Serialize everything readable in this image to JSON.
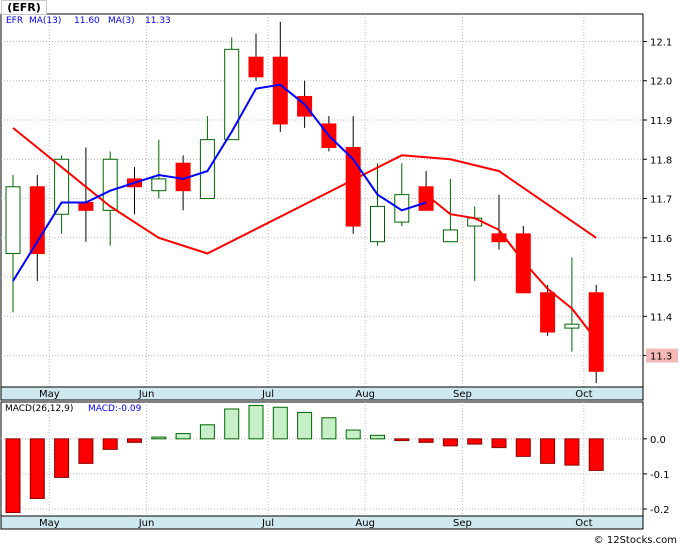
{
  "ticker_label": "(EFR)",
  "copyright": "© 12Stocks.com",
  "colors": {
    "up_fill": "#ffffff",
    "up_outline": "#006400",
    "down_fill": "#ff0000",
    "ma_fast": "#0000ff",
    "ma_slow": "#ff0000",
    "macd_pos_fill": "#c8f0c8",
    "macd_pos_outline": "#006400",
    "macd_neg_fill": "#ff0000",
    "axis_band": "#cfe8f0",
    "last_price_box": "#f4b8b8"
  },
  "chart_data": [
    {
      "type": "candlestick",
      "legend": {
        "symbol": "EFR",
        "ma13_label": "MA(13)",
        "ma13_value": "11.60",
        "ma3_label": "MA(3)",
        "ma3_value": "11.33"
      },
      "ylim": [
        11.22,
        12.17
      ],
      "y_ticks": [
        "11.3",
        "11.4",
        "11.5",
        "11.6",
        "11.7",
        "11.8",
        "11.9",
        "12.0",
        "12.1"
      ],
      "last_price_label": "11.3",
      "x_month_labels": [
        "May",
        "Jun",
        "Jul",
        "Aug",
        "Sep",
        "Oct"
      ],
      "candles": [
        {
          "o": 11.56,
          "h": 11.76,
          "l": 11.41,
          "c": 11.73
        },
        {
          "o": 11.73,
          "h": 11.76,
          "l": 11.49,
          "c": 11.56
        },
        {
          "o": 11.66,
          "h": 11.81,
          "l": 11.61,
          "c": 11.8
        },
        {
          "o": 11.69,
          "h": 11.83,
          "l": 11.59,
          "c": 11.67
        },
        {
          "o": 11.67,
          "h": 11.82,
          "l": 11.58,
          "c": 11.8
        },
        {
          "o": 11.75,
          "h": 11.78,
          "l": 11.66,
          "c": 11.73
        },
        {
          "o": 11.72,
          "h": 11.85,
          "l": 11.7,
          "c": 11.75
        },
        {
          "o": 11.79,
          "h": 11.81,
          "l": 11.67,
          "c": 11.72
        },
        {
          "o": 11.7,
          "h": 11.91,
          "l": 11.7,
          "c": 11.85
        },
        {
          "o": 11.85,
          "h": 12.11,
          "l": 11.85,
          "c": 12.08
        },
        {
          "o": 12.06,
          "h": 12.12,
          "l": 12.0,
          "c": 12.01
        },
        {
          "o": 12.06,
          "h": 12.15,
          "l": 11.87,
          "c": 11.89
        },
        {
          "o": 11.96,
          "h": 12.0,
          "l": 11.88,
          "c": 11.91
        },
        {
          "o": 11.89,
          "h": 11.91,
          "l": 11.82,
          "c": 11.83
        },
        {
          "o": 11.83,
          "h": 11.91,
          "l": 11.61,
          "c": 11.63
        },
        {
          "o": 11.59,
          "h": 11.79,
          "l": 11.58,
          "c": 11.68
        },
        {
          "o": 11.64,
          "h": 11.79,
          "l": 11.63,
          "c": 11.71
        },
        {
          "o": 11.73,
          "h": 11.77,
          "l": 11.67,
          "c": 11.67
        },
        {
          "o": 11.59,
          "h": 11.75,
          "l": 11.59,
          "c": 11.62
        },
        {
          "o": 11.63,
          "h": 11.68,
          "l": 11.49,
          "c": 11.65
        },
        {
          "o": 11.61,
          "h": 11.71,
          "l": 11.57,
          "c": 11.59
        },
        {
          "o": 11.61,
          "h": 11.63,
          "l": 11.46,
          "c": 11.46
        },
        {
          "o": 11.46,
          "h": 11.48,
          "l": 11.35,
          "c": 11.36
        },
        {
          "o": 11.37,
          "h": 11.55,
          "l": 11.31,
          "c": 11.38
        },
        {
          "o": 11.46,
          "h": 11.48,
          "l": 11.23,
          "c": 11.26
        }
      ],
      "series": [
        {
          "label_key": "ma13",
          "values": [
            11.88,
            null,
            null,
            null,
            11.68,
            null,
            11.6,
            null,
            11.56,
            null,
            null,
            null,
            null,
            null,
            null,
            null,
            11.81,
            null,
            11.8,
            null,
            11.77,
            null,
            null,
            null,
            11.6
          ]
        },
        {
          "label_key": "ma3",
          "values": [
            11.49,
            11.59,
            11.69,
            11.69,
            11.72,
            11.74,
            11.76,
            11.75,
            11.77,
            11.87,
            11.98,
            11.99,
            11.94,
            11.86,
            11.8,
            11.71,
            11.67,
            11.69,
            null,
            null,
            null,
            null,
            null,
            null,
            null
          ]
        },
        {
          "label_key": "ma3_late",
          "values": [
            null,
            null,
            null,
            null,
            null,
            null,
            null,
            null,
            null,
            null,
            null,
            null,
            null,
            null,
            null,
            null,
            null,
            11.71,
            11.66,
            11.65,
            11.62,
            11.54,
            11.47,
            11.42,
            11.34
          ]
        }
      ]
    },
    {
      "type": "bar",
      "legend": {
        "name": "MACD(26,12,9)",
        "value_label": "MACD:-0.09"
      },
      "ylim": [
        -0.22,
        0.105
      ],
      "y_ticks": [
        "0.0",
        "-0.1",
        "-0.2"
      ],
      "values": [
        -0.21,
        -0.17,
        -0.11,
        -0.07,
        -0.03,
        -0.01,
        0.005,
        0.015,
        0.04,
        0.085,
        0.095,
        0.09,
        0.075,
        0.06,
        0.025,
        0.01,
        -0.005,
        -0.01,
        -0.02,
        -0.015,
        -0.025,
        -0.05,
        -0.07,
        -0.075,
        -0.09
      ]
    }
  ]
}
